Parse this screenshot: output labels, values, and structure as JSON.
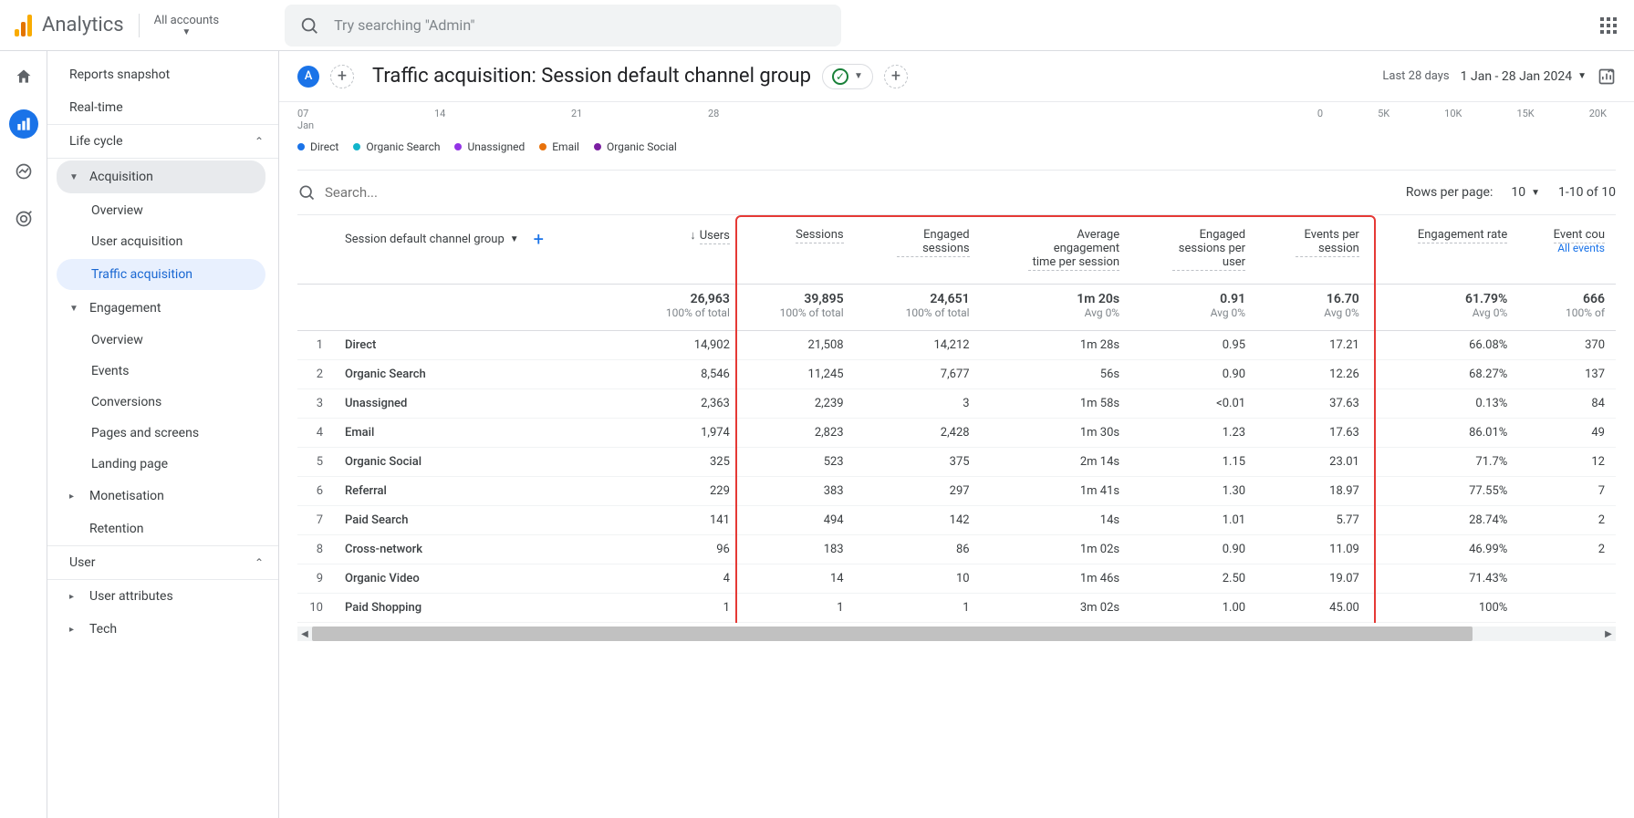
{
  "brand": "Analytics",
  "account_selector": "All accounts",
  "search_placeholder": "Try searching \"Admin\"",
  "sidebar": {
    "snapshot": "Reports snapshot",
    "realtime": "Real-time",
    "lifecycle": "Life cycle",
    "acquisition": "Acquisition",
    "acq_overview": "Overview",
    "user_acq": "User acquisition",
    "traffic_acq": "Traffic acquisition",
    "engagement": "Engagement",
    "eng_overview": "Overview",
    "events": "Events",
    "conversions": "Conversions",
    "pages": "Pages and screens",
    "landing": "Landing page",
    "monetisation": "Monetisation",
    "retention": "Retention",
    "user_section": "User",
    "user_attr": "User attributes",
    "tech": "Tech"
  },
  "page": {
    "avatar": "A",
    "title": "Traffic acquisition: Session default channel group",
    "date_label": "Last 28 days",
    "date_range": "1 Jan - 28 Jan 2024"
  },
  "chart": {
    "x_labels": [
      "07",
      "14",
      "21",
      "28"
    ],
    "x_sub": "Jan",
    "y_labels": [
      "0",
      "5K",
      "10K",
      "15K",
      "20K"
    ],
    "series": [
      {
        "name": "Direct",
        "color": "#1a73e8"
      },
      {
        "name": "Organic Search",
        "color": "#12b5cb"
      },
      {
        "name": "Unassigned",
        "color": "#9334e6"
      },
      {
        "name": "Email",
        "color": "#e8710a"
      },
      {
        "name": "Organic Social",
        "color": "#7b1fa2"
      }
    ]
  },
  "table_controls": {
    "search_placeholder": "Search...",
    "rpp_label": "Rows per page:",
    "rpp_value": "10",
    "range": "1-10 of 10"
  },
  "table": {
    "dimension": "Session default channel group",
    "columns": [
      "Users",
      "Sessions",
      "Engaged sessions",
      "Average engagement time per session",
      "Engaged sessions per user",
      "Events per session",
      "Engagement rate",
      "Event cou"
    ],
    "event_sub": "All events",
    "summary": {
      "users": {
        "v": "26,963",
        "sub": "100% of total"
      },
      "sessions": {
        "v": "39,895",
        "sub": "100% of total"
      },
      "engaged": {
        "v": "24,651",
        "sub": "100% of total"
      },
      "avg_time": {
        "v": "1m 20s",
        "sub": "Avg 0%"
      },
      "eng_per_user": {
        "v": "0.91",
        "sub": "Avg 0%"
      },
      "events_per": {
        "v": "16.70",
        "sub": "Avg 0%"
      },
      "eng_rate": {
        "v": "61.79%",
        "sub": "Avg 0%"
      },
      "event_count": {
        "v": "666",
        "sub": "100% of"
      }
    },
    "rows": [
      {
        "idx": "1",
        "dim": "Direct",
        "users": "14,902",
        "sessions": "21,508",
        "engaged": "14,212",
        "avg_time": "1m 28s",
        "eng_per_user": "0.95",
        "events_per": "17.21",
        "eng_rate": "66.08%",
        "event_count": "370"
      },
      {
        "idx": "2",
        "dim": "Organic Search",
        "users": "8,546",
        "sessions": "11,245",
        "engaged": "7,677",
        "avg_time": "56s",
        "eng_per_user": "0.90",
        "events_per": "12.26",
        "eng_rate": "68.27%",
        "event_count": "137"
      },
      {
        "idx": "3",
        "dim": "Unassigned",
        "users": "2,363",
        "sessions": "2,239",
        "engaged": "3",
        "avg_time": "1m 58s",
        "eng_per_user": "<0.01",
        "events_per": "37.63",
        "eng_rate": "0.13%",
        "event_count": "84"
      },
      {
        "idx": "4",
        "dim": "Email",
        "users": "1,974",
        "sessions": "2,823",
        "engaged": "2,428",
        "avg_time": "1m 30s",
        "eng_per_user": "1.23",
        "events_per": "17.63",
        "eng_rate": "86.01%",
        "event_count": "49"
      },
      {
        "idx": "5",
        "dim": "Organic Social",
        "users": "325",
        "sessions": "523",
        "engaged": "375",
        "avg_time": "2m 14s",
        "eng_per_user": "1.15",
        "events_per": "23.01",
        "eng_rate": "71.7%",
        "event_count": "12"
      },
      {
        "idx": "6",
        "dim": "Referral",
        "users": "229",
        "sessions": "383",
        "engaged": "297",
        "avg_time": "1m 41s",
        "eng_per_user": "1.30",
        "events_per": "18.97",
        "eng_rate": "77.55%",
        "event_count": "7"
      },
      {
        "idx": "7",
        "dim": "Paid Search",
        "users": "141",
        "sessions": "494",
        "engaged": "142",
        "avg_time": "14s",
        "eng_per_user": "1.01",
        "events_per": "5.77",
        "eng_rate": "28.74%",
        "event_count": "2"
      },
      {
        "idx": "8",
        "dim": "Cross-network",
        "users": "96",
        "sessions": "183",
        "engaged": "86",
        "avg_time": "1m 02s",
        "eng_per_user": "0.90",
        "events_per": "11.09",
        "eng_rate": "46.99%",
        "event_count": "2"
      },
      {
        "idx": "9",
        "dim": "Organic Video",
        "users": "4",
        "sessions": "14",
        "engaged": "10",
        "avg_time": "1m 46s",
        "eng_per_user": "2.50",
        "events_per": "19.07",
        "eng_rate": "71.43%",
        "event_count": ""
      },
      {
        "idx": "10",
        "dim": "Paid Shopping",
        "users": "1",
        "sessions": "1",
        "engaged": "1",
        "avg_time": "3m 02s",
        "eng_per_user": "1.00",
        "events_per": "45.00",
        "eng_rate": "100%",
        "event_count": ""
      }
    ]
  }
}
